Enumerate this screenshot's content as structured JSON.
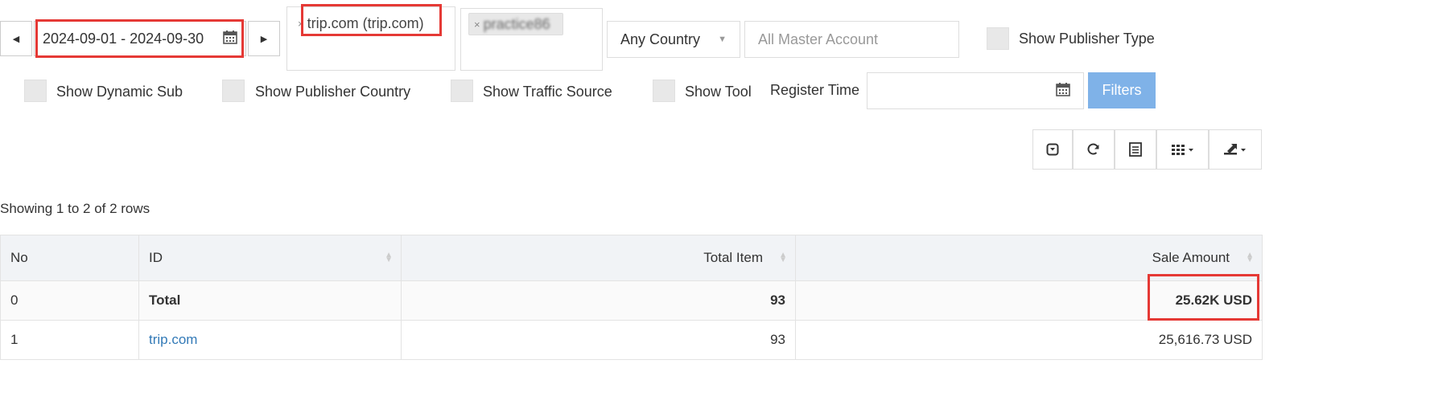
{
  "toolbar": {
    "prev_icon": "◀",
    "next_icon": "▶",
    "date_range": "2024-09-01 - 2024-09-30",
    "calendar_icon": "calendar-icon",
    "merchant_tag": "trip.com (trip.com)",
    "merchant_tag_close": "×",
    "publisher_tag": "practice86",
    "publisher_tag_close": "×",
    "country_select": "Any Country",
    "master_account_placeholder": "All Master Account",
    "show_publisher_type": "Show Publisher Type"
  },
  "options": {
    "show_dynamic_sub": "Show Dynamic Sub",
    "show_publisher_country": "Show Publisher Country",
    "show_traffic_source": "Show Traffic Source",
    "show_tool": "Show Tool",
    "register_time_label": "Register Time",
    "register_time_value": "",
    "filters_button": "Filters"
  },
  "table_tools": [
    "toggle-icon",
    "refresh-icon",
    "list-icon",
    "columns-icon",
    "export-icon"
  ],
  "pagination": {
    "showing_text": "Showing 1 to 2 of 2 rows"
  },
  "table": {
    "headers": {
      "no": "No",
      "id": "ID",
      "total_item": "Total Item",
      "sale_amount": "Sale Amount"
    },
    "rows": [
      {
        "no": "0",
        "id": "Total",
        "total_item": "93",
        "sale_amount": "25.62K USD"
      },
      {
        "no": "1",
        "id": "trip.com",
        "total_item": "93",
        "sale_amount": "25,616.73 USD"
      }
    ]
  },
  "colors": {
    "highlight": "#e53935",
    "filters_button": "#7fb2e8",
    "link": "#337ab7"
  }
}
